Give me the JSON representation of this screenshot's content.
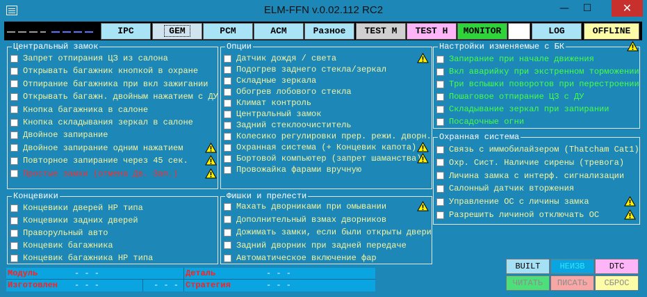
{
  "window": {
    "title": "ELM-FFN    v.0.02.112 RC2",
    "minimize": "—",
    "maximize": "☐",
    "close": "✕"
  },
  "toolbar": {
    "indicator_colors": [
      "#9a9a9a",
      "#5577ff"
    ],
    "buttons": [
      "IPC",
      "GEM",
      "PCM",
      "ACM",
      "Разное",
      "TEST M",
      "TEST H",
      "MONITOR",
      "",
      "LOG",
      "OFFLINE"
    ],
    "active": "GEM"
  },
  "groups": {
    "central_lock": {
      "title": "Центральный замок",
      "items": [
        {
          "label": "Запрет отпирания ЦЗ из салона",
          "warn": false
        },
        {
          "label": "Открывать багажник кнопкой в охране",
          "warn": false
        },
        {
          "label": "Отпирание багажника при вкл зажигании",
          "warn": false
        },
        {
          "label": "Открывать багажн. двойным нажатием с ДУ",
          "warn": false
        },
        {
          "label": "Кнопка багажника в салоне",
          "warn": false
        },
        {
          "label": "Кнопка складывания зеркал в салоне",
          "warn": false
        },
        {
          "label": "Двойное запирание",
          "warn": false
        },
        {
          "label": "Двойное запирание одним нажатием",
          "warn": true
        },
        {
          "label": "Повторное запирание через 45 сек.",
          "warn": true
        },
        {
          "label": "Простые замки (отмена Дв. Зап.)",
          "warn": true,
          "color": "red"
        }
      ]
    },
    "options": {
      "title": "Опции",
      "items": [
        {
          "label": "Датчик дождя / света",
          "warn": true
        },
        {
          "label": "Подогрев заднего стекла/зеркал",
          "warn": false
        },
        {
          "label": "Складные зеркала",
          "warn": false
        },
        {
          "label": "Обогрев лобового стекла",
          "warn": false
        },
        {
          "label": "Климат контроль",
          "warn": false
        },
        {
          "label": "Центральный замок",
          "warn": false
        },
        {
          "label": "Задний стеклоочиститель",
          "warn": false
        },
        {
          "label": "Колесико регулировки прер. режи. дворн.",
          "warn": false
        },
        {
          "label": "Охранная система (+ Концевик капота)",
          "warn": true
        },
        {
          "label": "Бортовой компьютер (запрет шаманства)",
          "warn": true
        },
        {
          "label": "Провожайка фарами вручную",
          "warn": false
        }
      ]
    },
    "bk_settings": {
      "title": "Настройки изменяемые с БК",
      "items": [
        {
          "label": "Запирание при начале движения",
          "warn": false
        },
        {
          "label": "Вкл аварийку при экстренном торможении",
          "warn": false
        },
        {
          "label": "Три вспышки поворотов при перестроении",
          "warn": false
        },
        {
          "label": "Пошаговое отпирание ЦЗ с ДУ",
          "warn": false
        },
        {
          "label": "Складывание зеркал при запирании",
          "warn": false
        },
        {
          "label": "Посадочные огни",
          "warn": false
        }
      ]
    },
    "endstops": {
      "title": "Концевики",
      "items": [
        {
          "label": "Концевики дверей НР типа"
        },
        {
          "label": "Концевики задних дверей"
        },
        {
          "label": "Праворульный авто"
        },
        {
          "label": "Концевик багажника"
        },
        {
          "label": "Концевик багажника НР типа"
        }
      ]
    },
    "features": {
      "title": "Фишки и прелести",
      "items": [
        {
          "label": "Махать дворниками при омывании",
          "warn": true
        },
        {
          "label": "Дополнительный взмах дворников",
          "warn": false
        },
        {
          "label": "Дожимать замки, если были открыты двери",
          "warn": false
        },
        {
          "label": "Задний дворник при задней передаче",
          "warn": false
        },
        {
          "label": "Автоматическое включение фар",
          "warn": false
        }
      ]
    },
    "security": {
      "title": "Охранная система",
      "items": [
        {
          "label": "Связь с иммобилайзером (Thatcham Cat1)",
          "warn": false
        },
        {
          "label": "Охр. Сист. Наличие сирены (тревога)",
          "warn": false
        },
        {
          "label": "Личина замка с интерф. сигнализации",
          "warn": false
        },
        {
          "label": "Салонный датчик вторжения",
          "warn": false
        },
        {
          "label": "Управление ОС с личины замка",
          "warn": true
        },
        {
          "label": "Разрешить личиной отключать ОС",
          "warn": true
        }
      ]
    }
  },
  "info": {
    "module_label": "Модуль",
    "module_value": "- - -",
    "made_label": "Изготовлен",
    "made_value1": "- - -",
    "made_value2": "- - -",
    "part_label": "Деталь",
    "part_value": "- - -",
    "strategy_label": "Стратегия",
    "strategy_value": "- - -"
  },
  "actions": {
    "built": "BUILT",
    "neizv": "НЕИЗВ",
    "dtc": "DTC",
    "read": "ЧИТАТЬ",
    "write": "ПИСАТЬ",
    "reset": "СБРОС"
  }
}
